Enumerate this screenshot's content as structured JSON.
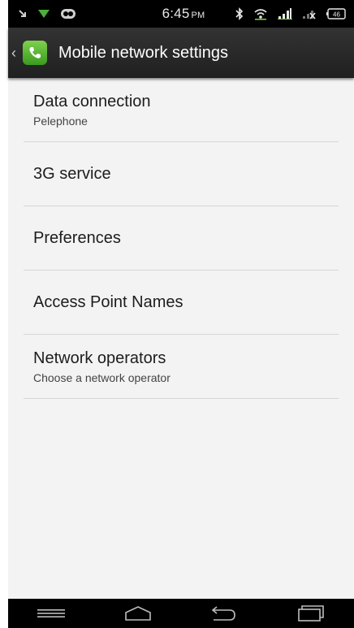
{
  "status_bar": {
    "time": "6:45",
    "ampm": "PM",
    "icons": [
      "missed-call-icon",
      "wifi-notification-icon",
      "voicemail-icon",
      "bluetooth-icon",
      "wifi-signal-icon",
      "cell-signal-icon",
      "no-sim-signal-icon",
      "battery-icon"
    ],
    "battery_label": "46"
  },
  "action_bar": {
    "title": "Mobile network settings",
    "icon": "phone-app-icon"
  },
  "settings": {
    "items": [
      {
        "title": "Data connection",
        "summary": "Pelephone"
      },
      {
        "title": "3G service"
      },
      {
        "title": "Preferences"
      },
      {
        "title": "Access Point Names"
      },
      {
        "title": "Network operators",
        "summary": "Choose a network operator"
      }
    ]
  },
  "nav_bar": {
    "buttons": [
      "menu-icon",
      "home-icon",
      "back-icon",
      "recent-apps-icon"
    ]
  },
  "colors": {
    "status_bar": "#000000",
    "action_bar": "#2a2a2a",
    "background": "#f3f3f3",
    "accent_green": "#5cb837",
    "divider": "#d6d6d6"
  }
}
